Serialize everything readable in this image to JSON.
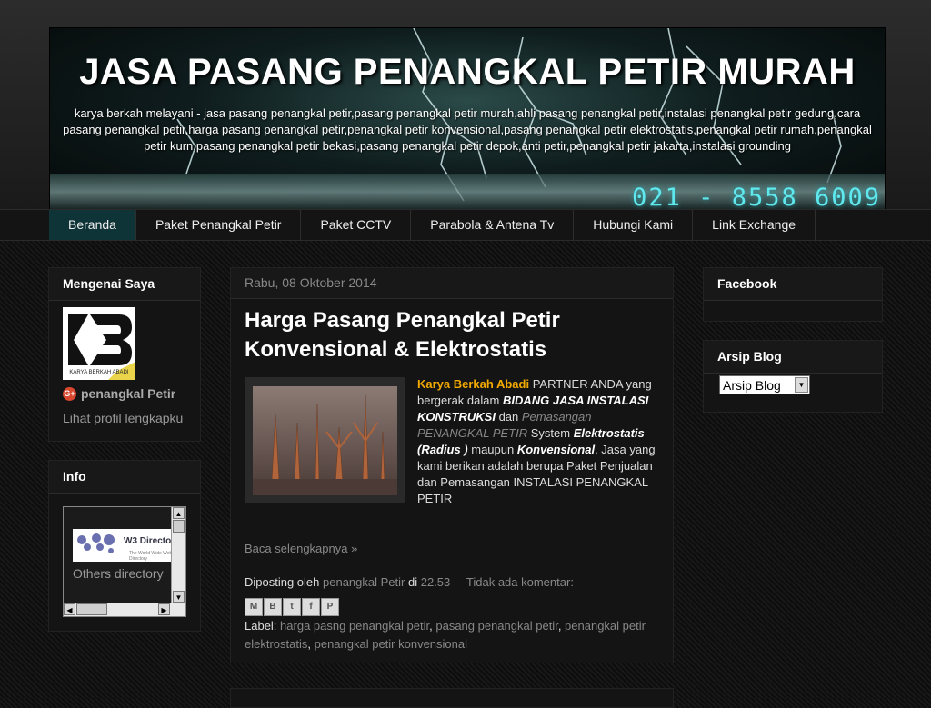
{
  "header": {
    "title": "JASA PASANG PENANGKAL PETIR MURAH",
    "description": "karya berkah melayani - jasa pasang penangkal petir,pasang penangkal petir murah,ahli pasang penangkal petir,instalasi penangkal petir gedung,cara pasang penangkal petir,harga pasang penangkal petir,penangkal petir konvensional,pasang penangkal petir elektrostatis,penangkal petir rumah,penangkal petir kurn,pasang penangkal petir bekasi,pasang penangkal petir depok,anti petir,penangkal petir jakarta,instalasi grounding",
    "phone": "021 - 8558 6009"
  },
  "nav": {
    "tabs": [
      "Beranda",
      "Paket Penangkal Petir",
      "Paket CCTV",
      "Parabola & Antena Tv",
      "Hubungi Kami",
      "Link Exchange"
    ]
  },
  "sidebar_left": {
    "about": {
      "title": "Mengenai Saya",
      "logo_caption": "KARYA BERKAH ABADI",
      "gplus_icon": "G+",
      "name": "penangkal Petir",
      "profile_link": "Lihat profil lengkapku"
    },
    "info": {
      "title": "Info",
      "w3_banner": "W3 Directo",
      "w3_subtext": "The World Wide Web Directory",
      "others_text": "Others directory"
    }
  },
  "post": {
    "date": "Rabu, 08 Oktober 2014",
    "title": "Harga Pasang Penangkal Petir Konvensional & Elektrostatis",
    "body": {
      "brand": "Karya Berkah Abadi",
      "t1": " PARTNER ANDA yang bergerak dalam ",
      "b1": "BIDANG JASA INSTALASI KONSTRUKSI",
      "t2": " dan ",
      "g1": "Pemasangan PENANGKAL PETIR",
      "t3": " System ",
      "b2": "Elektrostatis (Radius )",
      "t4": " maupun ",
      "b3": "Konvensional",
      "t5": ". Jasa yang kami berikan adalah berupa Paket Penjualan dan Pemasangan INSTALASI PENANGKAL PETIR"
    },
    "read_more": "Baca selengkapnya »",
    "footer": {
      "posted_by": "Diposting oleh",
      "author": "penangkal Petir",
      "at": "di",
      "time": "22.53",
      "comments": "Tidak ada komentar:"
    },
    "share_icons": [
      "email-icon",
      "blogger-icon",
      "twitter-icon",
      "facebook-icon",
      "pinterest-icon"
    ],
    "share_glyphs": [
      "M",
      "B",
      "t",
      "f",
      "P"
    ],
    "labels_prefix": "Label:",
    "labels": [
      "harga pasng penangkal petir",
      "pasang penangkal petir",
      "penangkal petir elektrostatis",
      "penangkal petir konvensional"
    ]
  },
  "sidebar_right": {
    "facebook": {
      "title": "Facebook"
    },
    "archive": {
      "title": "Arsip Blog",
      "select_value": "Arsip Blog"
    }
  },
  "colors": {
    "accent": "#f2a900",
    "nav_active": "#0f3438",
    "phone": "#5fe9ee"
  }
}
